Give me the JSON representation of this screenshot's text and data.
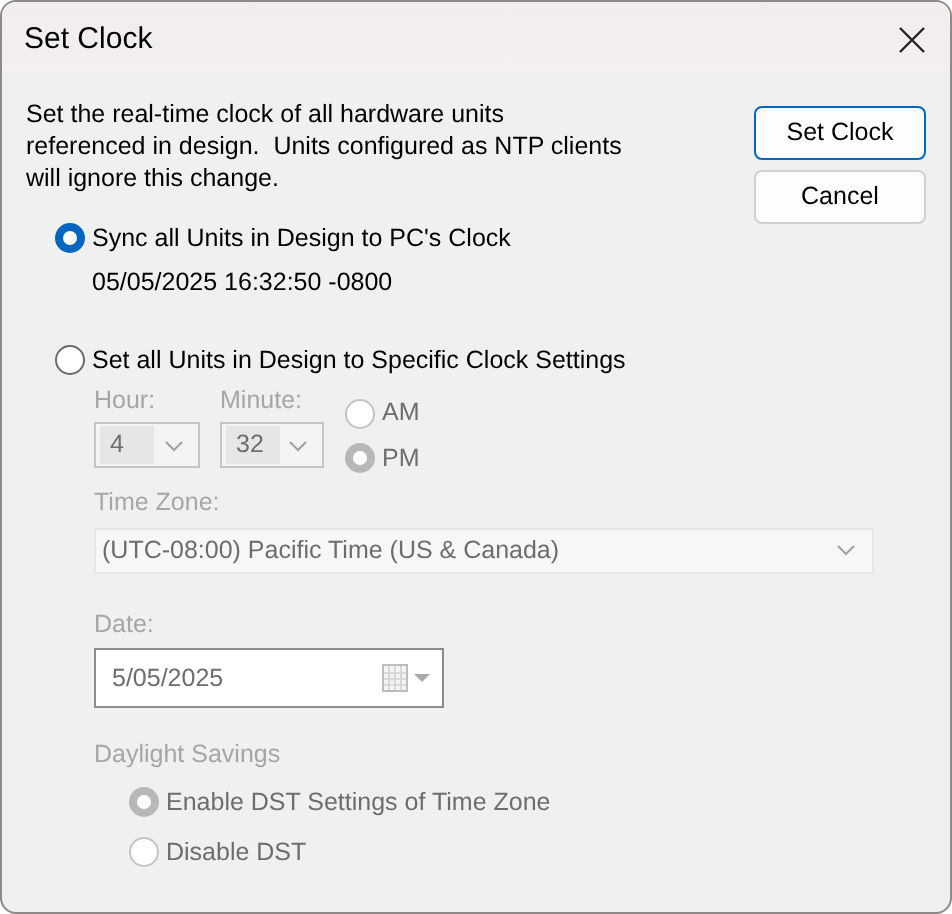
{
  "window": {
    "title": "Set Clock"
  },
  "description": "Set the real-time clock of all hardware units\nreferenced in design.  Units configured as NTP clients\nwill ignore this change.",
  "buttons": [
    {
      "label": "Set Clock",
      "default": true
    },
    {
      "label": "Cancel",
      "default": false
    }
  ],
  "mode_options": [
    {
      "label": "Sync all Units in Design to PC's Clock",
      "selected": true,
      "detail": "05/05/2025 16:32:50 -0800"
    },
    {
      "label": "Set all Units in Design to Specific Clock Settings",
      "selected": false
    }
  ],
  "specific_settings": {
    "disabled": true,
    "hour": {
      "label": "Hour:",
      "value": "4"
    },
    "minute": {
      "label": "Minute:",
      "value": "32"
    },
    "meridiem": [
      {
        "label": "AM",
        "selected": false
      },
      {
        "label": "PM",
        "selected": true
      }
    ],
    "time_zone": {
      "label": "Time Zone:",
      "value": "(UTC-08:00) Pacific Time (US & Canada)"
    },
    "date": {
      "label": "Date:",
      "value": "5/05/2025"
    },
    "daylight_savings": {
      "label": "Daylight Savings",
      "options": [
        {
          "label": "Enable DST Settings of Time Zone",
          "selected": true
        },
        {
          "label": "Disable DST",
          "selected": false
        }
      ]
    }
  }
}
